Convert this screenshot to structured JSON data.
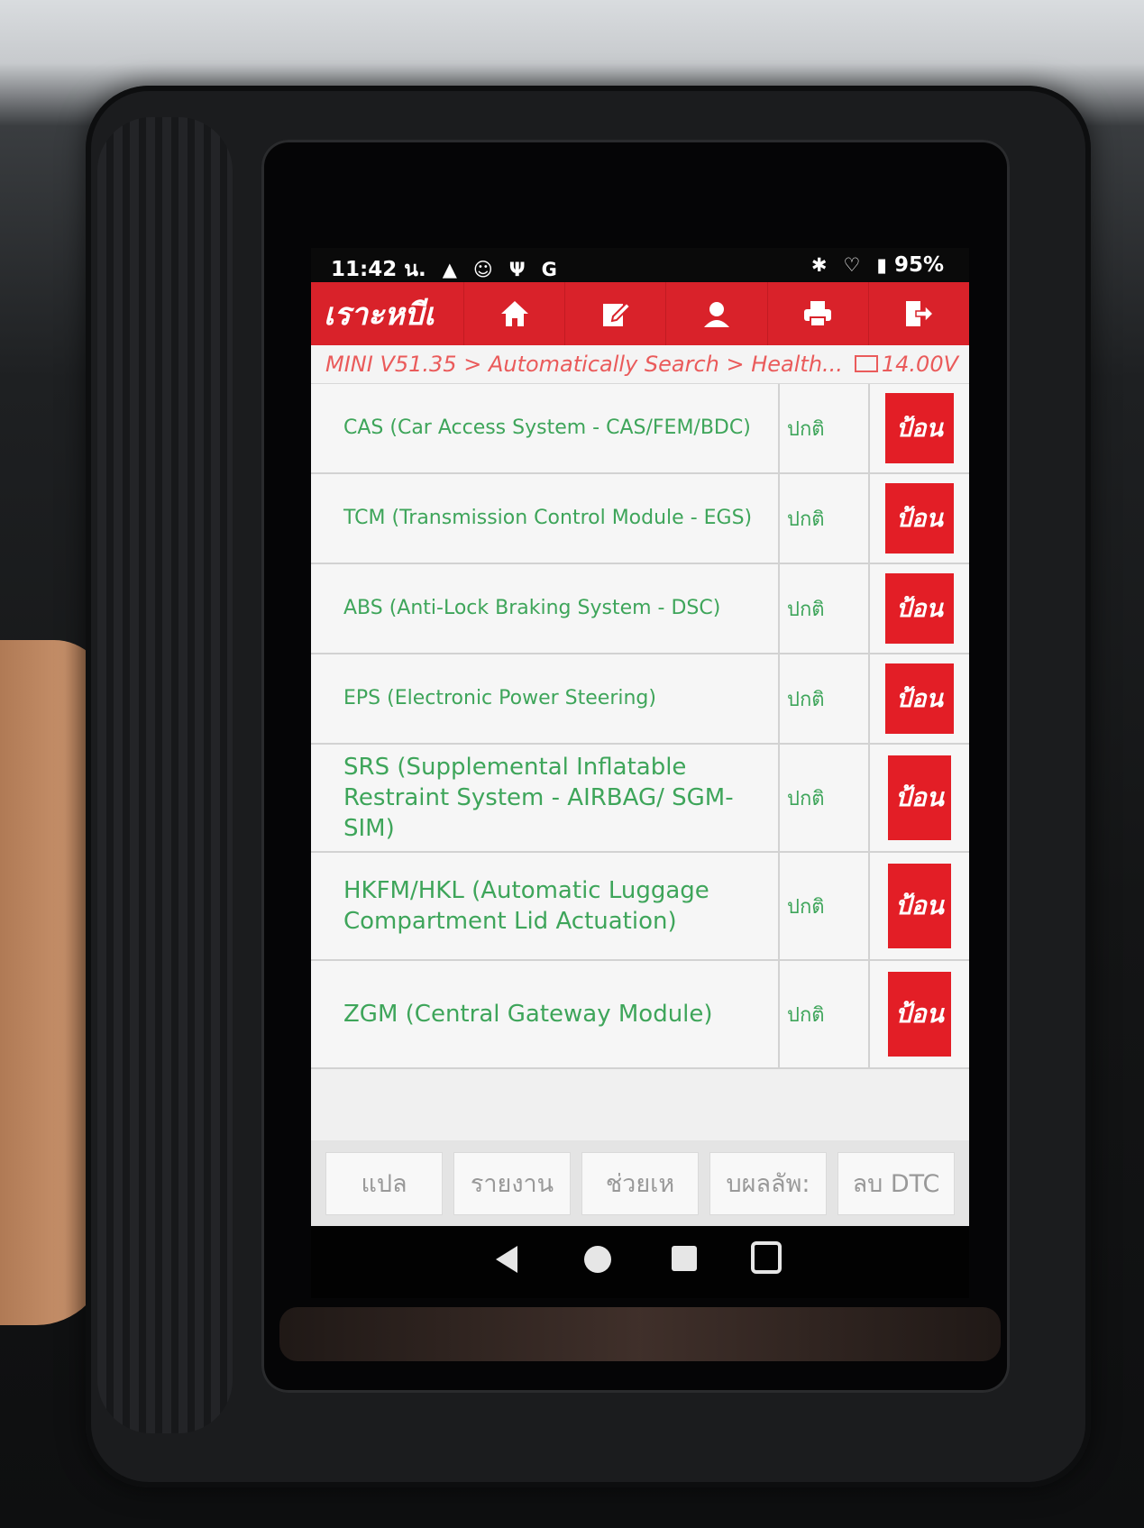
{
  "status_bar": {
    "time": "11:42 น.",
    "left_icons": [
      "warning-icon",
      "face-icon",
      "usb-icon",
      "g-icon"
    ],
    "battery": "95%",
    "right_icons": [
      "bluetooth-icon",
      "wifi-icon",
      "battery-icon"
    ]
  },
  "toolbar": {
    "about_label": "เราะหบีเ",
    "buttons": [
      "home-icon",
      "edit-icon",
      "user-icon",
      "print-icon",
      "exit-icon"
    ]
  },
  "breadcrumb": {
    "path": "MINI V51.35 > Automatically Search > Health...",
    "voltage": "14.00V"
  },
  "systems": [
    {
      "name": "CAS (Car Access System - CAS/FEM/BDC)",
      "status": "ปกติ",
      "action": "ป้อน"
    },
    {
      "name": "TCM (Transmission Control Module - EGS)",
      "status": "ปกติ",
      "action": "ป้อน"
    },
    {
      "name": "ABS (Anti-Lock Braking System - DSC)",
      "status": "ปกติ",
      "action": "ป้อน"
    },
    {
      "name": "EPS (Electronic Power Steering)",
      "status": "ปกติ",
      "action": "ป้อน"
    },
    {
      "name": "SRS (Supplemental Inflatable Restraint System - AIRBAG/ SGM-SIM)",
      "status": "ปกติ",
      "action": "ป้อน"
    },
    {
      "name": "HKFM/HKL (Automatic Luggage Compartment Lid Actuation)",
      "status": "ปกติ",
      "action": "ป้อน"
    },
    {
      "name": "ZGM (Central Gateway Module)",
      "status": "ปกติ",
      "action": "ป้อน"
    }
  ],
  "bottom_buttons": [
    "แปล",
    "รายงาน",
    "ช่วยเห",
    "บผลลัพ:",
    "ลบ DTC"
  ],
  "colors": {
    "accent_red": "#d9222a",
    "ok_green": "#3ea55a",
    "breadcrumb_red": "#ea5b5b"
  }
}
